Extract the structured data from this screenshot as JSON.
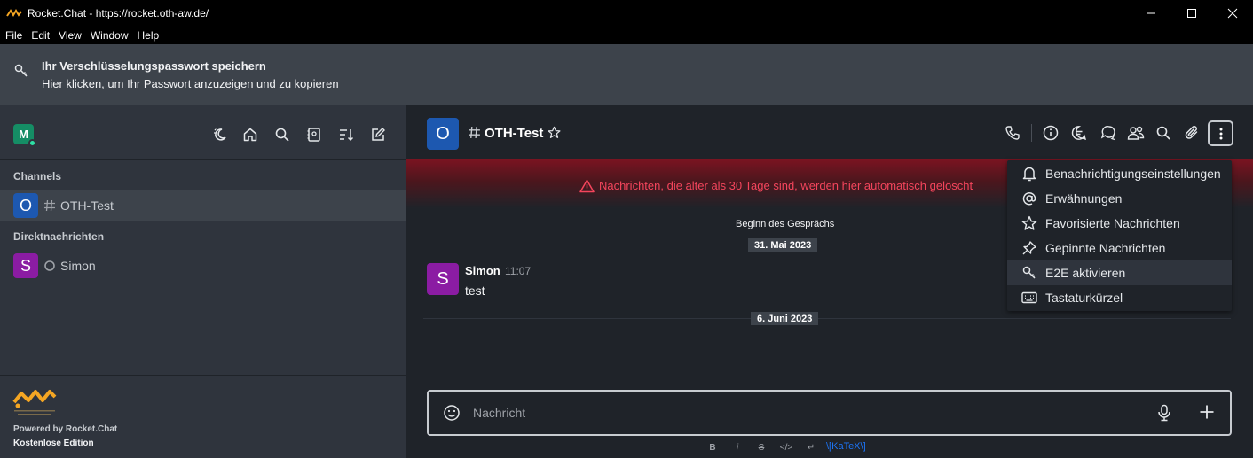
{
  "window": {
    "title": "Rocket.Chat - https://rocket.oth-aw.de/"
  },
  "menubar": [
    "File",
    "Edit",
    "View",
    "Window",
    "Help"
  ],
  "banner": {
    "title": "Ihr Verschlüsselungspasswort speichern",
    "text": "Hier klicken, um Ihr Passwort anzuzeigen und zu kopieren"
  },
  "sidebar": {
    "user_initial": "M",
    "sections": {
      "channels": "Channels",
      "direct": "Direktnachrichten"
    },
    "channels": [
      {
        "initial": "O",
        "name": "OTH-Test",
        "color": "#1d58b0"
      }
    ],
    "direct": [
      {
        "initial": "S",
        "name": "Simon",
        "color": "#8b1ca3"
      }
    ],
    "footer": {
      "powered": "Powered by Rocket.Chat",
      "edition": "Kostenlose Edition"
    }
  },
  "room": {
    "initial": "O",
    "name": "OTH-Test",
    "retention_warning": "Nachrichten, die älter als 30 Tage sind, werden hier automatisch gelöscht",
    "start_label": "Beginn des Gesprächs",
    "dates": [
      "31. Mai 2023",
      "6. Juni 2023"
    ],
    "messages": [
      {
        "initial": "S",
        "author": "Simon",
        "time": "11:07",
        "text": "test"
      }
    ]
  },
  "composer": {
    "placeholder": "Nachricht",
    "format_buttons": [
      "B",
      "i",
      "S",
      "</>",
      "↵"
    ],
    "katex": "\\[KaTeX\\]"
  },
  "kebab_menu": {
    "items": [
      {
        "label": "Benachrichtigungseinstellungen",
        "icon": "bell-icon"
      },
      {
        "label": "Erwähnungen",
        "icon": "at-icon"
      },
      {
        "label": "Favorisierte Nachrichten",
        "icon": "star-icon"
      },
      {
        "label": "Gepinnte Nachrichten",
        "icon": "pin-icon"
      },
      {
        "label": "E2E aktivieren",
        "icon": "key-icon",
        "highlighted": true
      },
      {
        "label": "Tastaturkürzel",
        "icon": "keyboard-icon"
      }
    ]
  },
  "colors": {
    "accent": "#1d74f5",
    "danger": "#f5455c",
    "online": "#2de0a5"
  }
}
